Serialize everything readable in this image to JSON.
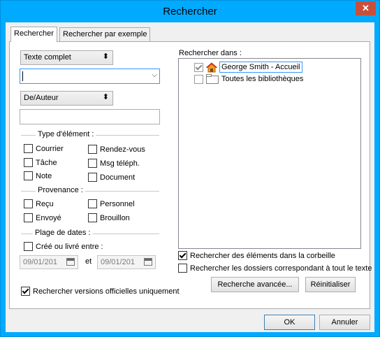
{
  "window": {
    "title": "Rechercher",
    "close_glyph": "✕"
  },
  "tabs": [
    {
      "label": "Rechercher",
      "active": true
    },
    {
      "label": "Rechercher par exemple",
      "active": false
    }
  ],
  "search": {
    "mode_select": "Texte complet",
    "query_value": "",
    "field_select": "De/Auteur",
    "field_value": ""
  },
  "item_type": {
    "label": "Type d'élément :",
    "options": [
      {
        "label": "Courrier",
        "checked": false
      },
      {
        "label": "Rendez-vous",
        "checked": false
      },
      {
        "label": "Tâche",
        "checked": false
      },
      {
        "label": "Msg téléph.",
        "checked": false
      },
      {
        "label": "Note",
        "checked": false
      },
      {
        "label": "Document",
        "checked": false
      }
    ]
  },
  "source": {
    "label": "Provenance :",
    "options": [
      {
        "label": "Reçu",
        "checked": false
      },
      {
        "label": "Personnel",
        "checked": false
      },
      {
        "label": "Envoyé",
        "checked": false
      },
      {
        "label": "Brouillon",
        "checked": false
      }
    ]
  },
  "dates": {
    "label": "Plage de dates :",
    "created_label": "Créé ou livré entre :",
    "created_checked": false,
    "from": "09/01/201",
    "and_label": "et",
    "to": "09/01/201"
  },
  "official_versions": {
    "label": "Rechercher versions officielles uniquement",
    "checked": true
  },
  "search_in": {
    "label": "Rechercher dans :",
    "nodes": [
      {
        "label": "George Smith - Accueil",
        "checked": true,
        "icon": "home-icon",
        "selected": true
      },
      {
        "label": "Toutes les bibliothèques",
        "checked": false,
        "icon": "folder-icon",
        "selected": false
      }
    ]
  },
  "trash": {
    "label": "Rechercher des éléments dans la corbeille",
    "checked": true
  },
  "folders_match": {
    "label": "Rechercher les dossiers correspondant à tout le texte",
    "checked": false
  },
  "buttons": {
    "advanced": "Recherche avancée...",
    "reset": "Réinitialiser",
    "ok": "OK",
    "cancel": "Annuler"
  },
  "colors": {
    "frame": "#00aaff",
    "close": "#c7503c",
    "focus": "#3399ff"
  }
}
